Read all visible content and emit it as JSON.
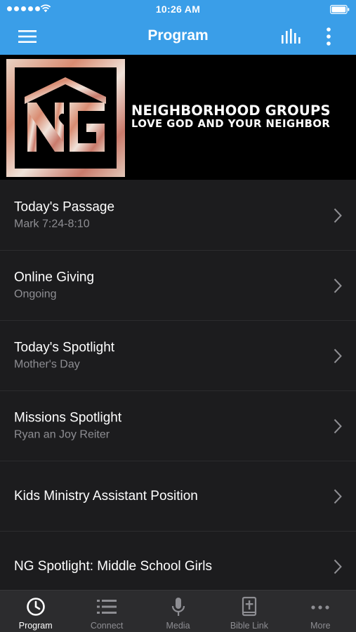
{
  "status_bar": {
    "time": "10:26 AM"
  },
  "app_bar": {
    "title": "Program"
  },
  "banner": {
    "logo_letters": "NG",
    "line1": "NEIGHBORHOOD GROUPS",
    "line2": "LOVE GOD AND YOUR NEIGHBOR"
  },
  "program_items": [
    {
      "title": "Today's Passage",
      "subtitle": "Mark 7:24-8:10"
    },
    {
      "title": "Online Giving",
      "subtitle": "Ongoing"
    },
    {
      "title": "Today's Spotlight",
      "subtitle": "Mother's Day"
    },
    {
      "title": "Missions Spotlight",
      "subtitle": "Ryan an Joy Reiter"
    },
    {
      "title": "Kids Ministry Assistant Position",
      "subtitle": ""
    },
    {
      "title": "NG Spotlight: Middle School Girls",
      "subtitle": ""
    }
  ],
  "tabs": [
    {
      "label": "Program",
      "icon": "clock-icon",
      "active": true
    },
    {
      "label": "Connect",
      "icon": "list-icon",
      "active": false
    },
    {
      "label": "Media",
      "icon": "microphone-icon",
      "active": false
    },
    {
      "label": "Bible Link",
      "icon": "bible-icon",
      "active": false
    },
    {
      "label": "More",
      "icon": "ellipsis-icon",
      "active": false
    }
  ],
  "colors": {
    "accent": "#3a9ee8",
    "background": "#1c1c1e",
    "tab_bar": "#2c2c2e",
    "subtitle": "#8e8e93"
  }
}
